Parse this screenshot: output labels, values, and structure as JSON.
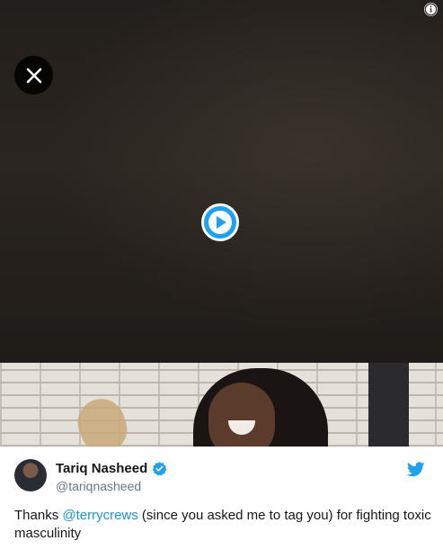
{
  "media": {
    "info_icon": "info-icon",
    "close_icon": "close-icon",
    "play_icon": "play-icon"
  },
  "tweet": {
    "author_name": "Tariq Nasheed",
    "author_handle": "@tariqnasheed",
    "verified_icon": "verified-badge-icon",
    "platform_icon": "twitter-bird-icon",
    "text_before": "Thanks ",
    "mention": "@terrycrews",
    "text_after": " (since you asked me to tag you) for fighting toxic masculinity"
  },
  "colors": {
    "accent": "#1da1f2",
    "mention": "#1b95e0",
    "text": "#14171a",
    "muted": "#657786"
  }
}
